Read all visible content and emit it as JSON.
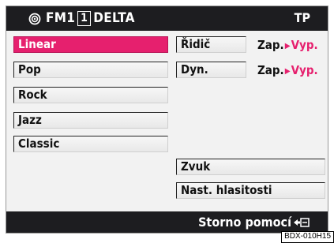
{
  "header": {
    "radio_icon": "radio-wave-icon",
    "band": "FM1",
    "preset": "1",
    "station": "DELTA",
    "tp": "TP"
  },
  "equalizer_presets": [
    {
      "label": "Linear",
      "selected": true
    },
    {
      "label": "Pop",
      "selected": false
    },
    {
      "label": "Rock",
      "selected": false
    },
    {
      "label": "Jazz",
      "selected": false
    },
    {
      "label": "Classic",
      "selected": false
    }
  ],
  "settings": [
    {
      "label": "Řidič",
      "on": "Zap.",
      "off": "Vyp.",
      "active": "off"
    },
    {
      "label": "Dyn.",
      "on": "Zap.",
      "off": "Vyp.",
      "active": "off"
    }
  ],
  "buttons": {
    "sound": "Zvuk",
    "volume": "Nast. hlasitosti"
  },
  "footer": {
    "hint": "Storno pomocí",
    "back_icon": "back-arrow-icon"
  },
  "figure_code": "BDX-010H15",
  "colors": {
    "accent": "#e6206e",
    "bar": "#1d1d20",
    "panel": "#f2f2f2"
  }
}
